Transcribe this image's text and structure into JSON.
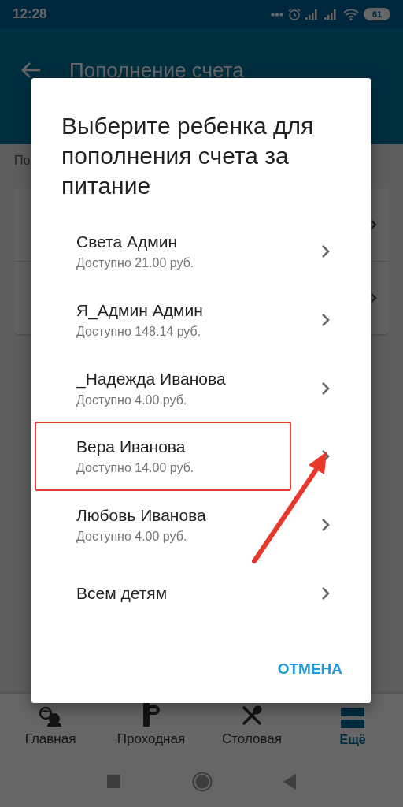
{
  "status_bar": {
    "time": "12:28",
    "battery": "61"
  },
  "app_bar": {
    "title": "Пополнение счета"
  },
  "content": {
    "label": "По"
  },
  "dialog": {
    "title": "Выберите ребенка для пополнения счета за питание",
    "items": [
      {
        "name": "Света Админ",
        "balance": "Доступно 21.00 руб.",
        "highlighted": false
      },
      {
        "name": "Я_Админ Админ",
        "balance": "Доступно 148.14 руб.",
        "highlighted": false
      },
      {
        "name": "_Надежда Иванова",
        "balance": "Доступно 4.00 руб.",
        "highlighted": false
      },
      {
        "name": "Вера Иванова",
        "balance": "Доступно 14.00 руб.",
        "highlighted": true
      },
      {
        "name": "Любовь Иванова",
        "balance": "Доступно 4.00 руб.",
        "highlighted": false
      },
      {
        "name": "Всем детям",
        "highlighted": false
      }
    ],
    "cancel": "ОТМЕНА"
  },
  "bottom_nav": [
    {
      "label": "Главная",
      "kind": "kids",
      "selected": false
    },
    {
      "label": "Проходная",
      "kind": "turnstile",
      "selected": false
    },
    {
      "label": "Столовая",
      "kind": "cutlery",
      "selected": false
    },
    {
      "label": "Ещё",
      "kind": "more",
      "selected": true
    }
  ]
}
